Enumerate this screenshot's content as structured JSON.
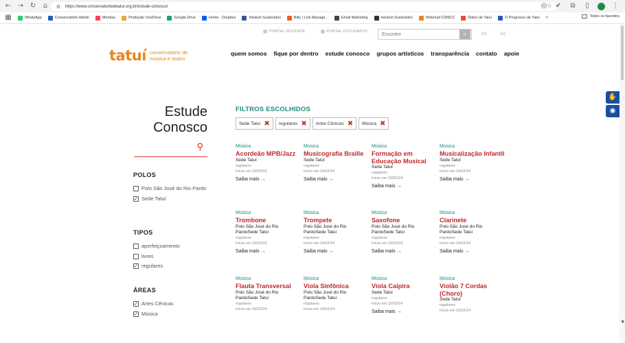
{
  "browser": {
    "url": "https://www.conservatoriodetatui.org.br/estude-conosco/",
    "bookmarks": [
      {
        "label": "WhatsApp",
        "color": "#25d366"
      },
      {
        "label": "Conservatório Admin",
        "color": "#2a5db0"
      },
      {
        "label": "Monday",
        "color": "#ff3d57"
      },
      {
        "label": "Produção OneDrive",
        "color": "#f2a33a"
      },
      {
        "label": "Google Drive",
        "color": "#1fa463"
      },
      {
        "label": "Home - Dropbox",
        "color": "#0061fe"
      },
      {
        "label": "Intranet Sustenidos",
        "color": "#3b5998"
      },
      {
        "label": "Bitly | Link Manage...",
        "color": "#ee6123"
      },
      {
        "label": "Email Marketing",
        "color": "#444444"
      },
      {
        "label": "Intranet Sustenidos",
        "color": "#333333"
      },
      {
        "label": "Webmail CDMCC",
        "color": "#e8861d"
      },
      {
        "label": "Diário de Tatuí",
        "color": "#e84c3d"
      },
      {
        "label": "O Progresso de Tatuí",
        "color": "#2a5db0"
      }
    ],
    "bookmarks_more": "»",
    "all_bookmarks": "Todos os favoritos"
  },
  "top": {
    "portal_docente": "PORTAL DOCENTE",
    "portal_estudantil": "PORTAL ESTUDANTIL",
    "search_placeholder": "Encontre",
    "lang_en": "EN",
    "lang_es": "ES"
  },
  "logo": {
    "word": "tatuí",
    "sub": "conservatório de música e teatro"
  },
  "nav": [
    "quem somos",
    "fique por dentro",
    "estude conosco",
    "grupos artísticos",
    "transparência",
    "contato",
    "apoie"
  ],
  "sidebar": {
    "title_line1": "Estude",
    "title_line2": "Conosco",
    "groups": [
      {
        "title": "POLOS",
        "options": [
          {
            "label": "Polo São José do Rio Pardo",
            "checked": false
          },
          {
            "label": "Sede Tatuí",
            "checked": true
          }
        ]
      },
      {
        "title": "TIPOS",
        "options": [
          {
            "label": "aperfeiçoamento",
            "checked": false
          },
          {
            "label": "livres",
            "checked": false
          },
          {
            "label": "regulares",
            "checked": true
          }
        ]
      },
      {
        "title": "ÁREAS",
        "options": [
          {
            "label": "Artes Cênicas",
            "checked": true
          },
          {
            "label": "Música",
            "checked": true
          }
        ]
      }
    ]
  },
  "filters": {
    "title": "FILTROS ESCOLHIDOS",
    "chips": [
      "Sede Tatuí",
      "regulares",
      "Artes Cênicas",
      "Música"
    ]
  },
  "courses": [
    {
      "cat": "Música",
      "title": "Acordeão MPB/Jazz",
      "loc": "Sede Tatuí",
      "type": "regulares",
      "date": "Início em 19/02/24",
      "more": "Saiba mais →"
    },
    {
      "cat": "Música",
      "title": "Musicografia Braille",
      "loc": "Sede Tatuí",
      "type": "regulares",
      "date": "Início em 19/02/24",
      "more": "Saiba mais →"
    },
    {
      "cat": "Música",
      "title": "Formação em Educação Musical",
      "loc": "Sede Tatuí",
      "type": "regulares",
      "date": "Início em 19/02/24",
      "more": "Saiba mais →"
    },
    {
      "cat": "Música",
      "title": "Musicalização Infantil",
      "loc": "Sede Tatuí",
      "type": "regulares",
      "date": "Início em 19/02/24",
      "more": "Saiba mais →"
    },
    {
      "cat": "Música",
      "title": "Trombone",
      "loc": "Polo São José do Rio PardoSede Tatuí",
      "type": "regulares",
      "date": "Início em 19/02/24",
      "more": "Saiba mais →"
    },
    {
      "cat": "Música",
      "title": "Trompete",
      "loc": "Polo São José do Rio PardoSede Tatuí",
      "type": "regulares",
      "date": "Início em 19/02/24",
      "more": "Saiba mais →"
    },
    {
      "cat": "Música",
      "title": "Saxofone",
      "loc": "Polo São José do Rio PardoSede Tatuí",
      "type": "regulares",
      "date": "Início em 19/02/24",
      "more": "Saiba mais →"
    },
    {
      "cat": "Música",
      "title": "Clarinete",
      "loc": "Polo São José do Rio PardoSede Tatuí",
      "type": "regulares",
      "date": "Início em 19/02/24",
      "more": "Saiba mais →"
    },
    {
      "cat": "Música",
      "title": "Flauta Transversal",
      "loc": "Polo São José do Rio PardoSede Tatuí",
      "type": "regulares",
      "date": "Início em 19/02/24",
      "more": ""
    },
    {
      "cat": "Música",
      "title": "Viola Sinfônica",
      "loc": "Polo São José do Rio PardoSede Tatuí",
      "type": "regulares",
      "date": "Início em 19/02/24",
      "more": ""
    },
    {
      "cat": "Música",
      "title": "Viola Caipira",
      "loc": "Sede Tatuí",
      "type": "regulares",
      "date": "Início em 19/02/24",
      "more": "Saiba mais →"
    },
    {
      "cat": "Música",
      "title": "Violão 7 Cordas (Choro)",
      "loc": "Sede Tatuí",
      "type": "regulares",
      "date": "Início em 19/02/24",
      "more": ""
    }
  ]
}
